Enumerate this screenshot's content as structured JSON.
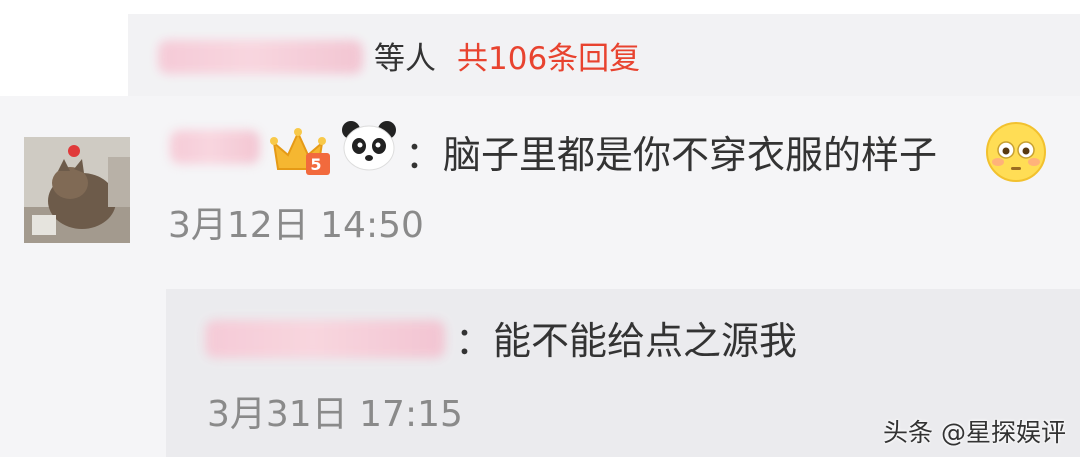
{
  "replies_summary": {
    "suffix": "等人",
    "link": "共106条回复"
  },
  "comment": {
    "text": "：脑子里都是你不穿衣服的样子",
    "timestamp": "3月12日 14:50",
    "badge_number": "5"
  },
  "reply": {
    "text": "：能不能给点之源我",
    "timestamp": "3月31日 17:15"
  },
  "watermark": "头条 @星探娱评",
  "colors": {
    "link": "#e8432f",
    "timestamp": "#8a8a8a",
    "background": "#f5f5f7"
  }
}
